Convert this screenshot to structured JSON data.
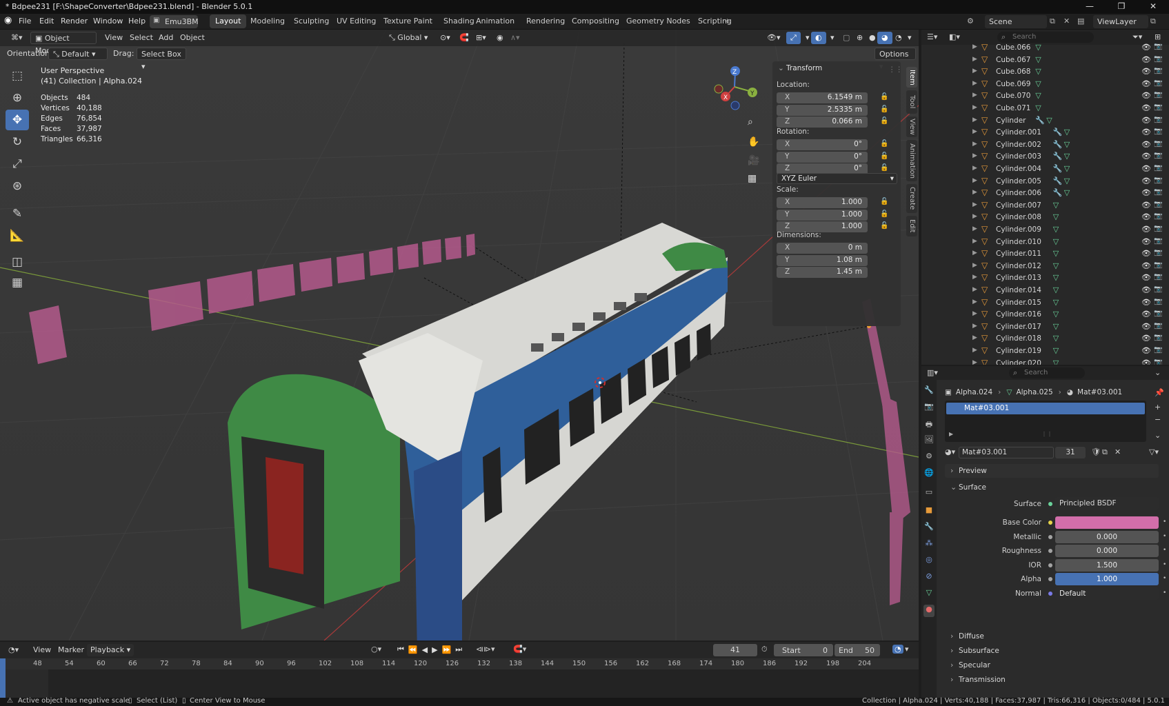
{
  "window": {
    "title": "* Bdpee231 [F:\\ShapeConverter\\Bdpee231.blend] - Blender 5.0.1",
    "controls": [
      "—",
      "❐",
      "✕"
    ]
  },
  "menu": [
    "File",
    "Edit",
    "Render",
    "Window",
    "Help"
  ],
  "workspace_select": "Emu3BM",
  "workspaces": [
    "Layout",
    "Modeling",
    "Sculpting",
    "UV Editing",
    "Texture Paint",
    "Shading",
    "Animation",
    "Rendering",
    "Compositing",
    "Geometry Nodes",
    "Scripting"
  ],
  "active_workspace": "Layout",
  "scene": {
    "label": "Scene",
    "view_layer": "ViewLayer"
  },
  "viewport": {
    "mode": "Object Mode",
    "menus": [
      "View",
      "Select",
      "Add",
      "Object"
    ],
    "transform_orientation": "Global",
    "orientation_label": "Orientation:",
    "orientation_value": "Default",
    "drag_label": "Drag:",
    "drag_value": "Select Box",
    "options_label": "Options",
    "perspective": "User Perspective",
    "collection_info": "(41) Collection | Alpha.024",
    "stats": [
      {
        "label": "Objects",
        "value": "484"
      },
      {
        "label": "Vertices",
        "value": "40,188"
      },
      {
        "label": "Edges",
        "value": "76,854"
      },
      {
        "label": "Faces",
        "value": "37,987"
      },
      {
        "label": "Triangles",
        "value": "66,316"
      }
    ],
    "gizmo": {
      "x": "X",
      "y": "Y",
      "z": "Z"
    }
  },
  "transform_panel": {
    "title": "Transform",
    "location_label": "Location:",
    "location": [
      {
        "axis": "X",
        "value": "6.1549 m"
      },
      {
        "axis": "Y",
        "value": "2.5335 m"
      },
      {
        "axis": "Z",
        "value": "0.066 m"
      }
    ],
    "rotation_label": "Rotation:",
    "rotation": [
      {
        "axis": "X",
        "value": "0°"
      },
      {
        "axis": "Y",
        "value": "0°"
      },
      {
        "axis": "Z",
        "value": "0°"
      }
    ],
    "rotation_mode": "XYZ Euler",
    "scale_label": "Scale:",
    "scale": [
      {
        "axis": "X",
        "value": "1.000"
      },
      {
        "axis": "Y",
        "value": "1.000"
      },
      {
        "axis": "Z",
        "value": "1.000"
      }
    ],
    "dimensions_label": "Dimensions:",
    "dimensions": [
      {
        "axis": "X",
        "value": "0 m"
      },
      {
        "axis": "Y",
        "value": "1.08 m"
      },
      {
        "axis": "Z",
        "value": "1.45 m"
      }
    ]
  },
  "sidebar_tabs": [
    "Item",
    "Tool",
    "View",
    "Animation",
    "Create",
    "Edit"
  ],
  "outliner": {
    "search_placeholder": "Search",
    "items": [
      {
        "name": "Cube.066",
        "wrench": false
      },
      {
        "name": "Cube.067",
        "wrench": false
      },
      {
        "name": "Cube.068",
        "wrench": false
      },
      {
        "name": "Cube.069",
        "wrench": false
      },
      {
        "name": "Cube.070",
        "wrench": false
      },
      {
        "name": "Cube.071",
        "wrench": false
      },
      {
        "name": "Cylinder",
        "wrench": true
      },
      {
        "name": "Cylinder.001",
        "wrench": true
      },
      {
        "name": "Cylinder.002",
        "wrench": true
      },
      {
        "name": "Cylinder.003",
        "wrench": true
      },
      {
        "name": "Cylinder.004",
        "wrench": true
      },
      {
        "name": "Cylinder.005",
        "wrench": true
      },
      {
        "name": "Cylinder.006",
        "wrench": true
      },
      {
        "name": "Cylinder.007",
        "wrench": false
      },
      {
        "name": "Cylinder.008",
        "wrench": false
      },
      {
        "name": "Cylinder.009",
        "wrench": false
      },
      {
        "name": "Cylinder.010",
        "wrench": false
      },
      {
        "name": "Cylinder.011",
        "wrench": false
      },
      {
        "name": "Cylinder.012",
        "wrench": false
      },
      {
        "name": "Cylinder.013",
        "wrench": false
      },
      {
        "name": "Cylinder.014",
        "wrench": false
      },
      {
        "name": "Cylinder.015",
        "wrench": false
      },
      {
        "name": "Cylinder.016",
        "wrench": false
      },
      {
        "name": "Cylinder.017",
        "wrench": false
      },
      {
        "name": "Cylinder.018",
        "wrench": false
      },
      {
        "name": "Cylinder.019",
        "wrench": false
      },
      {
        "name": "Cylinder.020",
        "wrench": false
      }
    ]
  },
  "properties": {
    "search_placeholder": "Search",
    "breadcrumb": [
      "Alpha.024",
      "Alpha.025",
      "Mat#03.001"
    ],
    "material_slot": "Mat#03.001",
    "material_name": "Mat#03.001",
    "user_count": "31",
    "sections": {
      "preview": "Preview",
      "surface": "Surface",
      "diffuse": "Diffuse",
      "subsurface": "Subsurface",
      "specular": "Specular",
      "transmission": "Transmission"
    },
    "surface": {
      "label": "Surface",
      "value": "Principled BSDF"
    },
    "fields": [
      {
        "label": "Base Color",
        "value": "",
        "color": "#d26eaa"
      },
      {
        "label": "Metallic",
        "value": "0.000"
      },
      {
        "label": "Roughness",
        "value": "0.000"
      },
      {
        "label": "IOR",
        "value": "1.500"
      },
      {
        "label": "Alpha",
        "value": "1.000",
        "color": "#4772b3"
      },
      {
        "label": "Normal",
        "value": "Default"
      }
    ]
  },
  "timeline": {
    "menus": [
      "View",
      "Marker",
      "Playback"
    ],
    "current_frame": "41",
    "start_label": "Start",
    "start": "0",
    "end_label": "End",
    "end": "50",
    "ruler": [
      "48",
      "54",
      "60",
      "66",
      "72",
      "78",
      "84",
      "90",
      "96",
      "102",
      "108",
      "114",
      "120",
      "126",
      "132",
      "138",
      "144",
      "150",
      "156",
      "162",
      "168",
      "174",
      "180",
      "186",
      "192",
      "198",
      "204"
    ]
  },
  "statusbar": {
    "warning": "Active object has negative scale",
    "select": "Select (List)",
    "center": "Center View to Mouse",
    "info": "Collection | Alpha.024 | Verts:40,188 | Faces:37,987 | Tris:66,316 | Objects:0/484 | 5.0.1"
  },
  "colors": {
    "accent": "#4772b3",
    "base_color": "#d26eaa",
    "train_blue": "#2f5f9a",
    "train_green": "#3f8a45"
  }
}
